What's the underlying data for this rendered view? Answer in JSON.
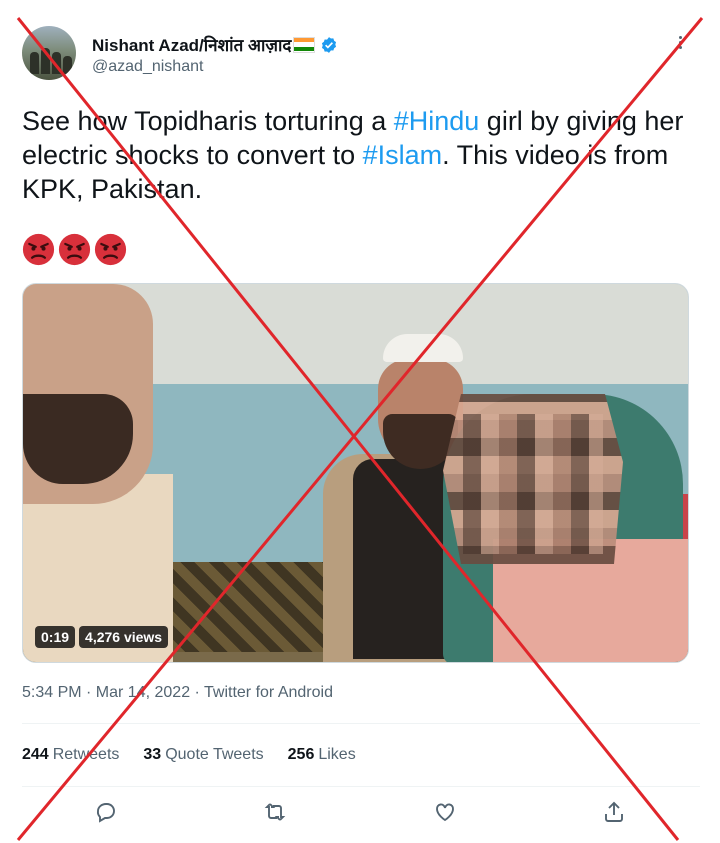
{
  "author": {
    "display_name": "Nishant Azad/निशांत आज़ाद",
    "handle": "@azad_nishant",
    "flag_icon": "india-flag-icon",
    "verified_icon": "verified-badge-icon",
    "verified_color": "#1d9bf0"
  },
  "tweet": {
    "text_1": "See how Topidharis torturing a ",
    "hashtag_1": "#Hindu",
    "text_2": " girl by giving her electric shocks to convert to ",
    "hashtag_2": "#Islam",
    "text_3": ". This video is from KPK, Pakistan.",
    "emojis": [
      "angry-face-icon",
      "angry-face-icon",
      "angry-face-icon"
    ]
  },
  "media": {
    "duration": "0:19",
    "views": "4,276 views"
  },
  "timestamp": "5:34 PM · Mar 14, 2022 · Twitter for Android",
  "stats": {
    "retweets_count": "244",
    "retweets_label": "Retweets",
    "quotes_count": "33",
    "quotes_label": "Quote Tweets",
    "likes_count": "256",
    "likes_label": "Likes"
  },
  "actions": [
    "reply-icon",
    "retweet-icon",
    "like-icon",
    "share-icon"
  ],
  "overlay": {
    "cross_color": "#e0262b"
  },
  "colors": {
    "hashtag": "#1d9bf0",
    "secondary_text": "#536471"
  }
}
